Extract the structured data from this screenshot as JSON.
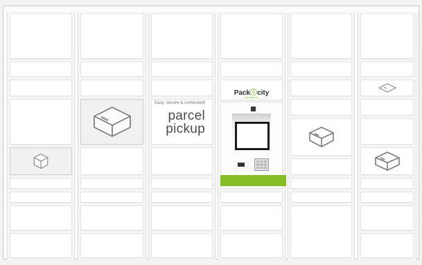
{
  "kiosk": {
    "brand_name": "Pack",
    "brand_city": "city",
    "brand_sub": "BY GEODIS",
    "accent_color": "#86bc25"
  },
  "promo": {
    "tagline": "Easy, secure & convenient",
    "line1": "parcel",
    "line2": "pickup"
  },
  "icons": {
    "box": "parcel-box-icon",
    "envelope": "envelope-icon"
  }
}
